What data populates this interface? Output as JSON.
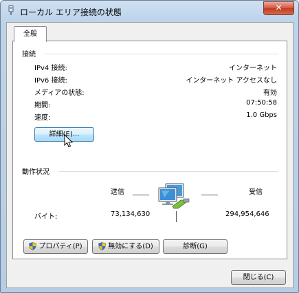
{
  "window": {
    "title": "ローカル エリア接続の状態",
    "close_glyph": "✕"
  },
  "tab": {
    "label": "全般"
  },
  "connection": {
    "title": "接続",
    "rows": [
      {
        "label": "IPv4 接続:",
        "value": "インターネット"
      },
      {
        "label": "IPv6 接続:",
        "value": "インターネット アクセスなし"
      },
      {
        "label": "メディアの状態:",
        "value": "有効"
      },
      {
        "label": "期間:",
        "value": "07:50:58"
      },
      {
        "label": "速度:",
        "value": "1.0 Gbps"
      }
    ],
    "details_button": "詳細(E)..."
  },
  "activity": {
    "title": "動作状況",
    "sent_label": "送信",
    "received_label": "受信",
    "bytes_label": "バイト:",
    "bytes_sent": "73,134,630",
    "bytes_received": "294,954,646"
  },
  "buttons": {
    "properties": "プロパティ(P)",
    "disable": "無効にする(D)",
    "diagnose": "診断(G)",
    "close": "閉じる(C)"
  },
  "icons": {
    "title": "network-adapter-icon",
    "shield": "uac-shield-icon",
    "activity": "network-computers-icon"
  }
}
